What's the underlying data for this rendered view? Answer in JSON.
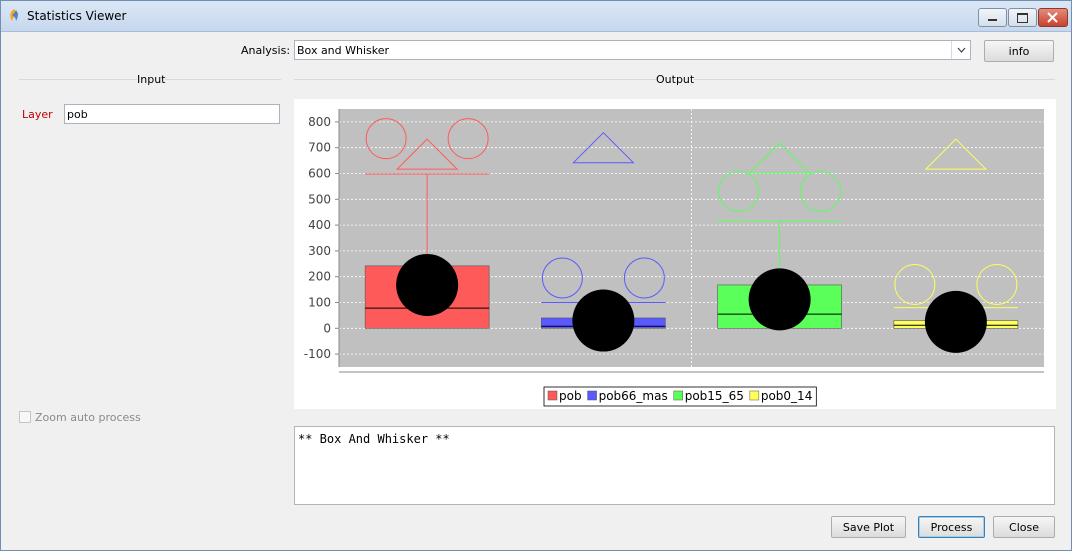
{
  "window": {
    "title": "Statistics Viewer"
  },
  "analysis": {
    "label": "Analysis:",
    "value": "Box and Whisker",
    "info_label": "info"
  },
  "sections": {
    "input": "Input",
    "output": "Output"
  },
  "input": {
    "layer_label": "Layer",
    "layer_value": "pob",
    "zoom_label": "Zoom auto process"
  },
  "output_text": "** Box And Whisker **",
  "buttons": {
    "save_plot": "Save Plot",
    "process": "Process",
    "close": "Close"
  },
  "colors": {
    "pob": "#ff5a5a",
    "pob66_mas": "#5a5aff",
    "pob15_65": "#5aff5a",
    "pob0_14": "#ffff5a",
    "plot_bg": "#c0c0c0"
  },
  "chart_data": {
    "type": "box",
    "ylim": [
      -150,
      850
    ],
    "yticks": [
      800,
      700,
      600,
      500,
      400,
      300,
      200,
      100,
      0,
      -100
    ],
    "grid": true,
    "legend_position": "bottom",
    "series": [
      {
        "name": "pob",
        "color": "#ff5a5a",
        "q1": 0,
        "median": 78,
        "q3": 242,
        "whisker_low": 0,
        "whisker_high": 598,
        "mean": 168,
        "outliers": [
          735,
          735
        ],
        "far_out": [
          675
        ]
      },
      {
        "name": "pob66_mas",
        "color": "#5a5aff",
        "q1": 0,
        "median": 8,
        "q3": 40,
        "whisker_low": 0,
        "whisker_high": 100,
        "mean": 30,
        "outliers": [
          195,
          195
        ],
        "far_out": [
          700
        ]
      },
      {
        "name": "pob15_65",
        "color": "#5aff5a",
        "q1": 0,
        "median": 55,
        "q3": 168,
        "whisker_low": 0,
        "whisker_high": 415,
        "mean": 112,
        "outliers": [
          530,
          530
        ],
        "far_out": [
          660
        ]
      },
      {
        "name": "pob0_14",
        "color": "#ffff5a",
        "q1": 0,
        "median": 12,
        "q3": 30,
        "whisker_low": 0,
        "whisker_high": 80,
        "mean": 25,
        "outliers": [
          170,
          170
        ],
        "far_out": [
          675
        ]
      }
    ]
  }
}
